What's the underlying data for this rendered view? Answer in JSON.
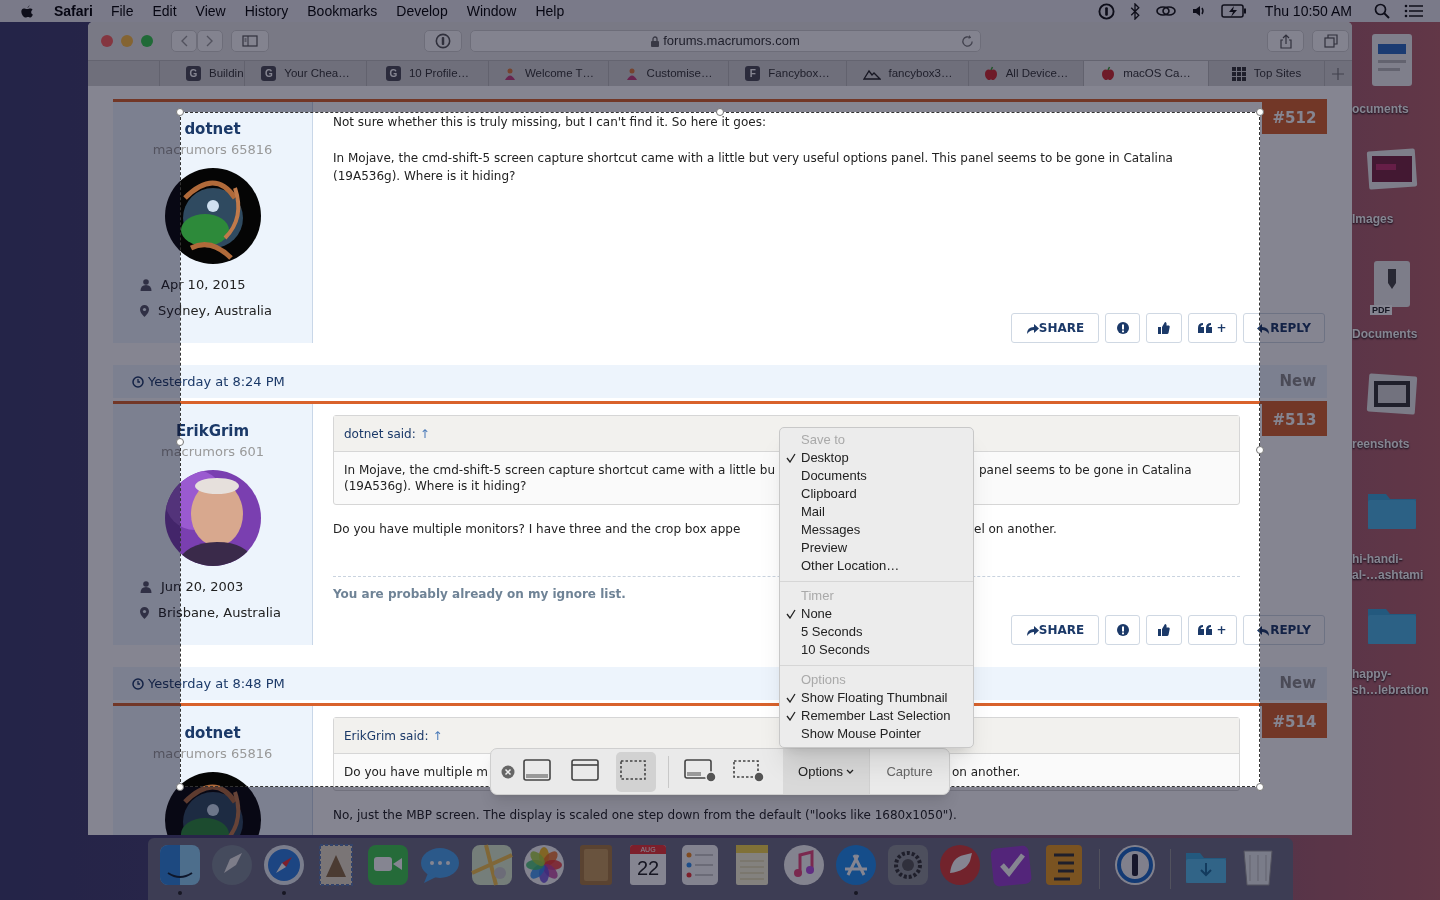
{
  "menu_bar": {
    "app_name": "Safari",
    "menus": [
      "File",
      "Edit",
      "View",
      "History",
      "Bookmarks",
      "Develop",
      "Window",
      "Help"
    ],
    "clock": "Thu 10:50 AM"
  },
  "browser": {
    "address": "forums.macrumors.com",
    "tabs": [
      {
        "title": "Buildin",
        "kind": "letter",
        "icon_text": "G",
        "selected": false
      },
      {
        "title": "Your Chea…",
        "kind": "letter",
        "icon_text": "G",
        "selected": false
      },
      {
        "title": "10 Profile…",
        "kind": "letter",
        "icon_text": "G",
        "selected": false
      },
      {
        "title": "Welcome T…",
        "kind": "figure",
        "selected": false
      },
      {
        "title": "Customise…",
        "kind": "figure",
        "selected": false
      },
      {
        "title": "Fancybox…",
        "kind": "letter",
        "icon_text": "F",
        "selected": false
      },
      {
        "title": "fancybox3…",
        "kind": "mountain",
        "selected": false
      },
      {
        "title": "All Device…",
        "kind": "apple",
        "selected": false
      },
      {
        "title": "macOS Ca…",
        "kind": "apple",
        "selected": true
      },
      {
        "title": "Top Sites",
        "kind": "grid",
        "selected": false
      }
    ]
  },
  "posts": [
    {
      "author": "dotnet",
      "rank": "macrumors 65816",
      "joined": "Apr 10, 2015",
      "location": "Sydney, Australia",
      "number": "#512",
      "content": [
        {
          "kind": "text",
          "text": "Not sure whether this is truly missing, but I can't find it. So here it goes:"
        },
        {
          "kind": "text",
          "text": "In Mojave, the cmd-shift-5 screen capture shortcut came with a little but very useful options panel. This panel seems to be gone in Catalina (19A536g). Where is it hiding?"
        }
      ],
      "actions": [
        {
          "kind": "share",
          "label": "SHARE"
        },
        {
          "kind": "report"
        },
        {
          "kind": "like"
        },
        {
          "kind": "quote",
          "label": "+"
        },
        {
          "kind": "reply",
          "label": "REPLY"
        }
      ]
    },
    {
      "date_bar": {
        "time": "Yesterday at 8:24 PM",
        "status": "New"
      },
      "author": "ErikGrim",
      "rank": "macrumors 601",
      "joined": "Jun 20, 2003",
      "location": "Brisbane, Australia",
      "number": "#513",
      "content": [
        {
          "kind": "quote",
          "source": "dotnet said:",
          "link": "↑",
          "lines": [
            {
              "left": "In Mojave, the cmd-shift-5 screen capture shortcut came with a little bu",
              "right": "panel seems to be gone in Catalina"
            },
            {
              "left": "(19A536g). Where is it hiding?"
            }
          ]
        },
        {
          "kind": "split",
          "left": "Do you have multiple monitors? I have three and the crop box appe",
          "right": "el on another."
        },
        {
          "kind": "signature",
          "text": "You are probably already on my ignore list."
        }
      ],
      "actions": [
        {
          "kind": "share",
          "label": "SHARE"
        },
        {
          "kind": "report"
        },
        {
          "kind": "like"
        },
        {
          "kind": "quote",
          "label": "+"
        },
        {
          "kind": "reply",
          "label": "REPLY"
        }
      ]
    },
    {
      "date_bar": {
        "time": "Yesterday at 8:48 PM",
        "status": "New"
      },
      "author": "dotnet",
      "rank": "macrumors 65816",
      "number": "#514",
      "content": [
        {
          "kind": "quote",
          "source": "ErikGrim said:",
          "link": "↑",
          "lines": [
            {
              "left": "Do you have multiple m",
              "right": "on another."
            }
          ]
        },
        {
          "kind": "text",
          "text": "No, just the MBP screen. The display is scaled one step down from the default (\"looks like 1680x1050\")."
        }
      ]
    }
  ],
  "capture_toolbar": {
    "tools": [
      {
        "kind": "screen",
        "selected": false
      },
      {
        "kind": "window",
        "selected": false
      },
      {
        "kind": "selection",
        "selected": true
      },
      {
        "kind": "record_screen",
        "selected": false
      },
      {
        "kind": "record_selection",
        "selected": false
      }
    ],
    "options": {
      "label": "Options",
      "expanded": true
    },
    "capture_label": "Capture"
  },
  "options_menu": {
    "sections": [
      {
        "header": "Save to",
        "items": [
          {
            "label": "Desktop",
            "checked": true
          },
          {
            "label": "Documents",
            "checked": false
          },
          {
            "label": "Clipboard",
            "checked": false
          },
          {
            "label": "Mail",
            "checked": false
          },
          {
            "label": "Messages",
            "checked": false
          },
          {
            "label": "Preview",
            "checked": false
          },
          {
            "label": "Other Location…",
            "checked": false
          }
        ]
      },
      {
        "header": "Timer",
        "items": [
          {
            "label": "None",
            "checked": true
          },
          {
            "label": "5 Seconds",
            "checked": false
          },
          {
            "label": "10 Seconds",
            "checked": false
          }
        ]
      },
      {
        "header": "Options",
        "items": [
          {
            "label": "Show Floating Thumbnail",
            "checked": true
          },
          {
            "label": "Remember Last Selection",
            "checked": true
          },
          {
            "label": "Show Mouse Pointer",
            "checked": false
          }
        ]
      }
    ]
  },
  "desktop_icons": [
    {
      "kind": "document",
      "lines": [
        "ocuments"
      ]
    },
    {
      "kind": "photos",
      "lines": [
        "Images"
      ]
    },
    {
      "kind": "pdf",
      "badge_text": "PDF",
      "lines": [
        "Documents"
      ]
    },
    {
      "kind": "screenshots",
      "lines": [
        "reenshots"
      ]
    },
    {
      "kind": "folder",
      "lines": [
        "hi-handi-",
        "al-…ashtami"
      ]
    },
    {
      "kind": "folder",
      "lines": [
        "happy-",
        "sh…lebration"
      ]
    }
  ],
  "dock": {
    "apps": [
      {
        "kind": "smile",
        "running": true
      },
      {
        "kind": "rocket",
        "running": false
      },
      {
        "kind": "compass",
        "running": true
      },
      {
        "kind": "stamp",
        "running": false
      },
      {
        "kind": "video",
        "running": false
      },
      {
        "kind": "bubble",
        "running": false
      },
      {
        "kind": "map",
        "running": false
      },
      {
        "kind": "flower",
        "running": false
      },
      {
        "kind": "book",
        "running": false
      },
      {
        "kind": "calendar",
        "month": "AUG",
        "day": "22",
        "running": false
      },
      {
        "kind": "list",
        "running": false
      },
      {
        "kind": "notepad",
        "running": false
      },
      {
        "kind": "music",
        "running": false
      },
      {
        "kind": "store",
        "running": true
      },
      {
        "kind": "gear",
        "running": false
      },
      {
        "kind": "animal",
        "running": false
      },
      {
        "kind": "check",
        "running": false
      },
      {
        "kind": "checklist",
        "running": false
      },
      {
        "kind": "separator"
      },
      {
        "kind": "keyhole",
        "running": false
      },
      {
        "kind": "separator"
      },
      {
        "kind": "download_folder",
        "running": false
      },
      {
        "kind": "trash",
        "running": false
      }
    ]
  }
}
